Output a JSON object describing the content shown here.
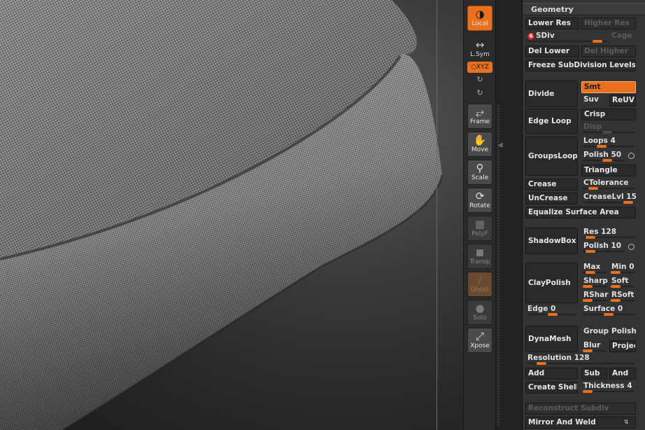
{
  "toolbar": {
    "local": "Local",
    "lsym": "L.Sym",
    "xyz": "○XYZ",
    "frame": "Frame",
    "move": "Move",
    "scale": "Scale",
    "rotate": "Rotate",
    "polyf": "PolyF",
    "transp": "Transp",
    "ghost": "Ghost",
    "solo": "Solo",
    "xpose": "Xpose"
  },
  "geometry": {
    "title": "Geometry",
    "lower_res": "Lower Res",
    "higher_res": "Higher Res",
    "sdiv_value": "6",
    "sdiv_label": "SDiv",
    "sdiv_level": 0.58,
    "cage": "Cage",
    "del_lower": "Del Lower",
    "del_higher": "Del Higher",
    "freeze": "Freeze SubDivision Levels",
    "divide": "Divide",
    "smt": "Smt",
    "suv": "Suv",
    "reuv": "ReUV",
    "edge_loop": "Edge Loop",
    "crisp": "Crisp",
    "disp": "Disp",
    "loops_label": "Loops",
    "loops_value": "4",
    "groups_loops": "GroupsLoops",
    "polish_label": "Polish",
    "polish_value": "50",
    "triangle": "Triangle",
    "crease": "Crease",
    "ctolerance": "CTolerance",
    "uncrease": "UnCrease",
    "creaselvl_label": "CreaseLvl",
    "creaselvl_value": "15",
    "equalize": "Equalize Surface Area",
    "shadowbox": "ShadowBox",
    "res_label": "Res",
    "res_value": "128",
    "sb_polish_label": "Polish",
    "sb_polish_value": "10",
    "claypolish": "ClayPolish",
    "max": "Max",
    "min_label": "Min",
    "min_value": "0",
    "sharp": "Sharp",
    "soft": "Soft",
    "rshar": "RShar",
    "rsoft": "RSoft",
    "edge_label": "Edge",
    "edge_value": "0",
    "surface_label": "Surface",
    "surface_value": "0",
    "dynamesh": "DynaMesh",
    "group": "Group",
    "polish_btn": "Polish",
    "blur": "Blur",
    "project": "Projec",
    "resolution_label": "Resolution",
    "resolution_value": "128",
    "add": "Add",
    "sub": "Sub",
    "and": "And",
    "create_shell": "Create Shell",
    "thickness_label": "Thickness",
    "thickness_value": "4",
    "reconstruct": "Reconstruct Subdiv",
    "mirror_weld": "Mirror And Weld"
  },
  "colors": {
    "accent": "#e8701e",
    "panel": "#333333",
    "button": "#2a2a2a"
  }
}
